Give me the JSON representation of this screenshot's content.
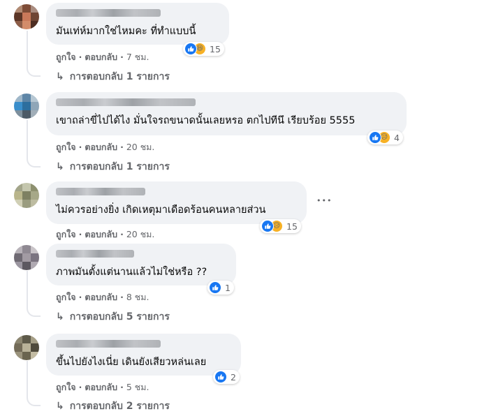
{
  "comments": [
    {
      "text": "มันเท่ห์มากใช่ไหมคะ ที่ทำแบบนี้",
      "like_label": "ถูกใจ",
      "reply_label": "ตอบกลับ",
      "time": "7 ชม.",
      "reaction_icons": [
        "like-icon",
        "haha-icon"
      ],
      "reaction_count": "15",
      "replies_label": "การตอบกลับ 1 รายการ"
    },
    {
      "text": "เขาถล่าขี่ไปได้ไง มั่นใจรถขนาดนั้นเลยหรอ ตกไปทีนึ เรียบร้อย 5555",
      "like_label": "ถูกใจ",
      "reply_label": "ตอบกลับ",
      "time": "20 ชม.",
      "reaction_icons": [
        "like-icon",
        "sad-icon"
      ],
      "reaction_count": "4",
      "replies_label": "การตอบกลับ 1 รายการ"
    },
    {
      "text": "ไม่ควรอย่างยิ่ง เกิดเหตุมาเดือดร้อนคนหลายส่วน",
      "like_label": "ถูกใจ",
      "reply_label": "ตอบกลับ",
      "time": "20 ชม.",
      "reaction_icons": [
        "like-icon",
        "sad-icon"
      ],
      "reaction_count": "15",
      "more_label": "•••"
    },
    {
      "text": "ภาพมันตั้งแต่นานแล้วไม่ใช่หรือ ??",
      "like_label": "ถูกใจ",
      "reply_label": "ตอบกลับ",
      "time": "8 ชม.",
      "reaction_icons": [
        "like-icon"
      ],
      "reaction_count": "1",
      "replies_label": "การตอบกลับ 5 รายการ"
    },
    {
      "text": "ขึ้นไปยังไงเนี่ย เดินยังเสียวหล่นเลย",
      "like_label": "ถูกใจ",
      "reply_label": "ตอบกลับ",
      "time": "5 ชม.",
      "reaction_icons": [
        "like-icon"
      ],
      "reaction_count": "2",
      "replies_label": "การตอบกลับ 2 รายการ"
    }
  ],
  "colors": {
    "bubble": "#f0f2f5",
    "meta_text": "#65676b",
    "like_blue": "#1877f2",
    "emoji_yellow": "#f7b125"
  }
}
